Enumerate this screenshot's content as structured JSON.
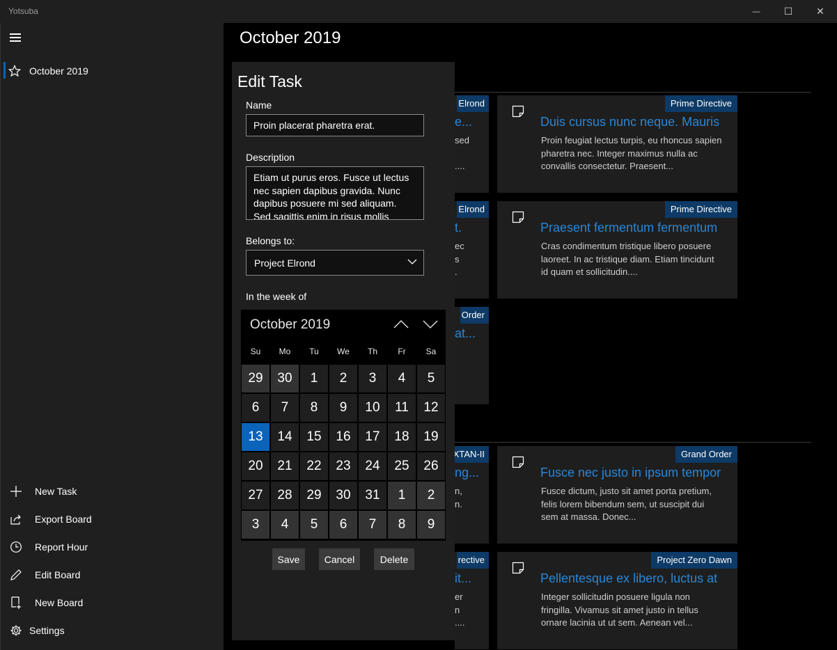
{
  "window": {
    "title": "Yotsuba",
    "minimize": "—",
    "maximize": "☐",
    "close": "✕"
  },
  "sidebar": {
    "boards": [
      {
        "label": "October 2019",
        "icon": "star-icon"
      }
    ],
    "actions": [
      {
        "label": "New Task",
        "icon": "plus-icon"
      },
      {
        "label": "Export Board",
        "icon": "share-icon"
      },
      {
        "label": "Report Hour",
        "icon": "clock-icon"
      },
      {
        "label": "Edit Board",
        "icon": "pencil-icon"
      },
      {
        "label": "New Board",
        "icon": "new-board-icon"
      }
    ],
    "settings": {
      "label": "Settings",
      "icon": "gear-icon"
    }
  },
  "main": {
    "title": "October 2019",
    "partial_cards": [
      {
        "tag": "Elrond",
        "title": "e...",
        "desc": "sed\n\n...."
      },
      {
        "tag": "Elrond",
        "title": "t.",
        "desc": "ec\ns\n."
      },
      {
        "tag": "Order",
        "title": "at...",
        "desc": ""
      },
      {
        "tag": "XTAN-II",
        "title": "ng...",
        "desc": "n,\nn."
      },
      {
        "tag": "rective",
        "title": "it...",
        "desc": "er\nn\n...."
      }
    ],
    "cards": [
      {
        "tag": "Prime Directive",
        "title": "Duis cursus nunc neque. Mauris",
        "desc": "Proin feugiat lectus turpis, eu rhoncus sapien pharetra nec. Integer maximus nulla ac convallis consectetur. Praesent..."
      },
      {
        "tag": "Prime Directive",
        "title": "Praesent fermentum fermentum",
        "desc": "Cras condimentum tristique libero posuere laoreet. In ac tristique diam. Etiam tincidunt id quam et sollicitudin...."
      },
      {
        "tag": "Grand Order",
        "title": "Fusce nec justo in ipsum tempor",
        "desc": "Fusce dictum, justo sit amet porta pretium, felis lorem bibendum sem, ut suscipit dui sem at massa. Donec..."
      },
      {
        "tag": "Project Zero Dawn",
        "title": "Pellentesque ex libero, luctus at",
        "desc": "Integer sollicitudin posuere ligula non fringilla. Vivamus sit amet justo in tellus ornare lacinia ut ut sem. Aenean vel..."
      }
    ]
  },
  "dialog": {
    "title": "Edit Task",
    "name_label": "Name",
    "name_value": "Proin placerat pharetra erat.",
    "description_label": "Description",
    "description_value": "Etiam ut purus eros. Fusce ut lectus nec sapien dapibus gravida. Nunc dapibus posuere mi sed aliquam. Sed sagittis enim in risus mollis ornare.",
    "belongs_label": "Belongs to:",
    "belongs_value": "Project Elrond",
    "week_label": "In the week of",
    "calendar": {
      "month": "October 2019",
      "dow": [
        "Su",
        "Mo",
        "Tu",
        "We",
        "Th",
        "Fr",
        "Sa"
      ],
      "days": [
        [
          "29",
          "30",
          "1",
          "2",
          "3",
          "4",
          "5"
        ],
        [
          "6",
          "7",
          "8",
          "9",
          "10",
          "11",
          "12"
        ],
        [
          "13",
          "14",
          "15",
          "16",
          "17",
          "18",
          "19"
        ],
        [
          "20",
          "21",
          "22",
          "23",
          "24",
          "25",
          "26"
        ],
        [
          "27",
          "28",
          "29",
          "30",
          "31",
          "1",
          "2"
        ],
        [
          "3",
          "4",
          "5",
          "6",
          "7",
          "8",
          "9"
        ]
      ],
      "selected": "13"
    },
    "save": "Save",
    "cancel": "Cancel",
    "delete": "Delete"
  }
}
